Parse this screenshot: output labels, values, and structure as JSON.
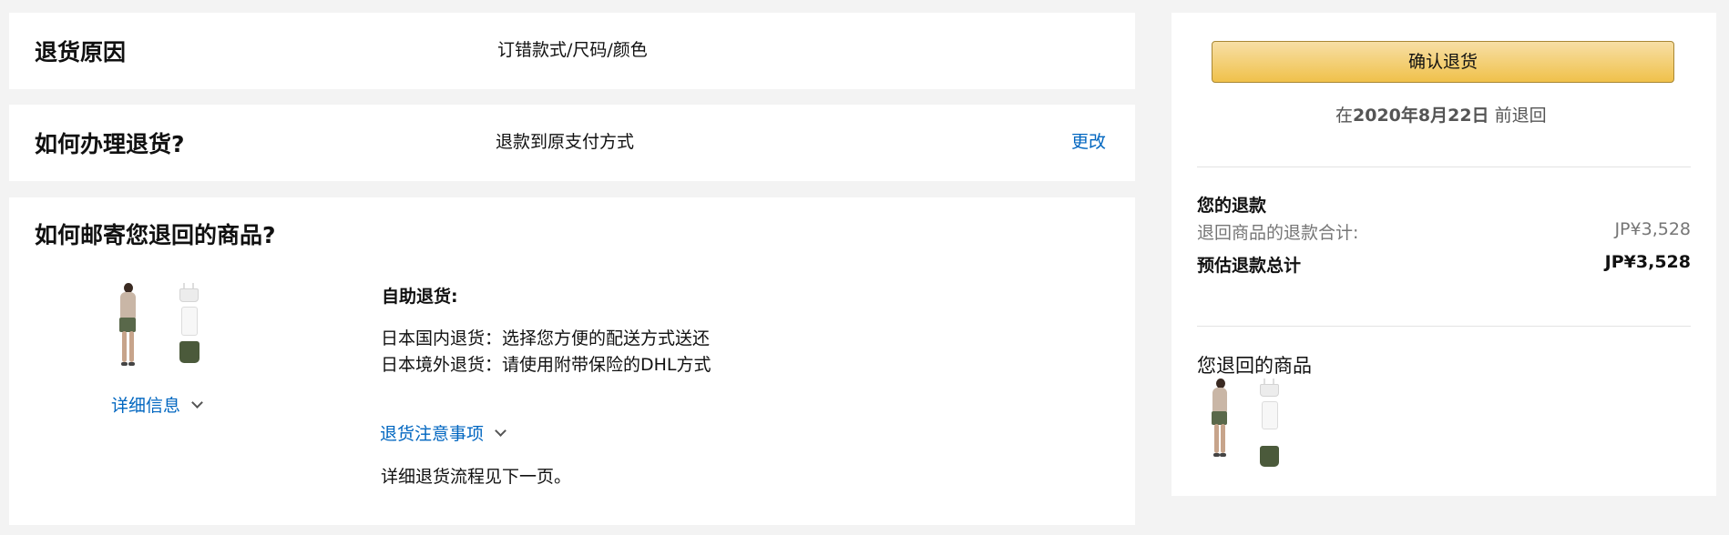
{
  "return_reason": {
    "title": "退货原因",
    "value": "订错款式/尺码/颜色"
  },
  "return_method": {
    "title": "如何办理退货?",
    "value": "退款到原支付方式",
    "change_link": "更改"
  },
  "shipping": {
    "title": "如何邮寄您退回的商品?",
    "details_link": "详细信息",
    "self_return_label": "自助退货:",
    "domestic": "日本国内退货：选择您方便的配送方式送还",
    "overseas": "日本境外退货：请使用附带保险的DHL方式",
    "notes_link": "退货注意事项",
    "next_page_note": "详细退货流程见下一页。"
  },
  "sidebar": {
    "confirm_button": "确认退货",
    "deadline_prefix": "在",
    "deadline_date": "2020年8月22日",
    "deadline_suffix": " 前退回",
    "refund_title": "您的退款",
    "refund_subtotal_label": "退回商品的退款合计:",
    "refund_subtotal_value": "JP¥3,528",
    "refund_total_label": "预估退款总计",
    "refund_total_value": "JP¥3,528",
    "returned_items_title": "您退回的商品"
  },
  "icons": [
    "chevron-down-icon"
  ],
  "colors": {
    "link": "#0066c0",
    "button_top": "#f7dfa5",
    "button_bottom": "#f0c14b",
    "page_bg": "#f3f3f3"
  }
}
